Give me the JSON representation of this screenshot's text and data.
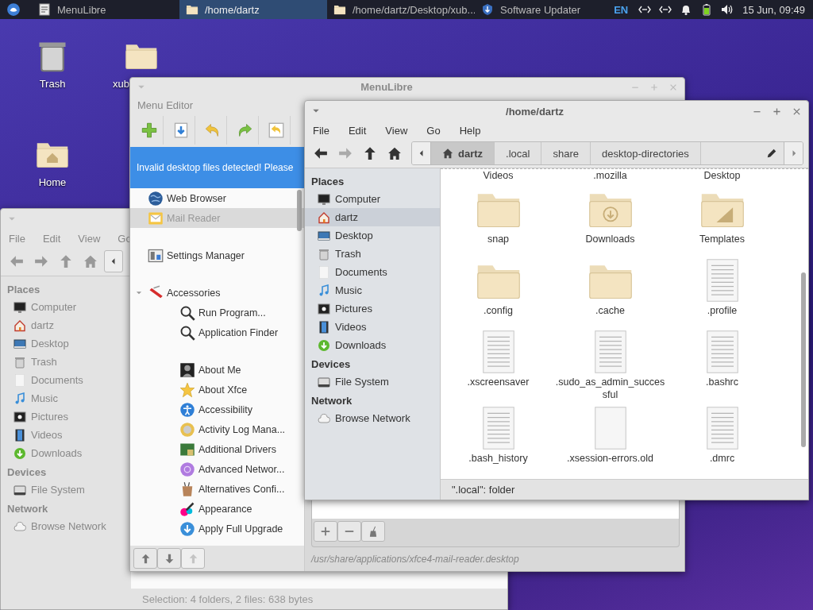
{
  "panel": {
    "tasks": [
      {
        "label": "MenuLibre",
        "kind": "editor",
        "selected": false
      },
      {
        "label": "/home/dartz",
        "kind": "folder",
        "selected": true
      },
      {
        "label": "/home/dartz/Desktop/xub...",
        "kind": "folder",
        "selected": false
      },
      {
        "label": "Software Updater",
        "kind": "updater",
        "selected": false
      }
    ],
    "keyboard_layout": "EN",
    "clock": "15 Jun, 09:49"
  },
  "desktop_icons": [
    {
      "label": "Trash",
      "kind": "trash"
    },
    {
      "label": "xub",
      "kind": "folder"
    },
    {
      "label": "Home",
      "kind": "home-folder"
    }
  ],
  "back_file_manager": {
    "menu": [
      "File",
      "Edit",
      "View",
      "Go"
    ],
    "nav": [
      {
        "kind": "back",
        "disabled": false
      },
      {
        "kind": "forward",
        "disabled": false
      },
      {
        "kind": "up",
        "disabled": false
      },
      {
        "kind": "home",
        "disabled": false
      }
    ],
    "sidebar": [
      {
        "heading": "Places",
        "items": [
          {
            "label": "Computer",
            "kind": "computer",
            "selected": false
          },
          {
            "label": "dartz",
            "kind": "home",
            "selected": false
          },
          {
            "label": "Desktop",
            "kind": "desktop",
            "selected": false
          },
          {
            "label": "Trash",
            "kind": "trash",
            "selected": false
          },
          {
            "label": "Documents",
            "kind": "documents",
            "selected": false
          },
          {
            "label": "Music",
            "kind": "music",
            "selected": false
          },
          {
            "label": "Pictures",
            "kind": "pictures",
            "selected": false
          },
          {
            "label": "Videos",
            "kind": "videos",
            "selected": false
          },
          {
            "label": "Downloads",
            "kind": "downloads",
            "selected": false
          }
        ]
      },
      {
        "heading": "Devices",
        "items": [
          {
            "label": "File System",
            "kind": "drive",
            "selected": false
          }
        ]
      },
      {
        "heading": "Network",
        "items": [
          {
            "label": "Browse Network",
            "kind": "network",
            "selected": false
          }
        ]
      }
    ],
    "status_bar": "Selection: 4 folders, 2 files: 638 bytes"
  },
  "menu_editor": {
    "title": "MenuLibre",
    "header": "Menu Editor",
    "toolbar": [
      {
        "kind": "add",
        "disabled": false
      },
      {
        "kind": "save",
        "disabled": false
      },
      {
        "kind": "undo",
        "disabled": false
      },
      {
        "kind": "redo",
        "disabled": false
      },
      {
        "kind": "revert",
        "disabled": false
      }
    ],
    "info_bar": "Invalid desktop files detected! Please",
    "tree": [
      {
        "label": "Web Browser",
        "kind": "globe",
        "selected": false
      },
      {
        "label": "Mail Reader",
        "kind": "mail",
        "selected": true
      },
      {
        "kind": "separator"
      },
      {
        "label": "Settings Manager",
        "kind": "settings",
        "selected": false
      },
      {
        "kind": "separator"
      },
      {
        "label": "Accessories",
        "kind": "accessories",
        "selected": false,
        "expanded": true,
        "children": [
          {
            "label": "Run Program...",
            "kind": "search",
            "selected": false
          },
          {
            "label": "Application Finder",
            "kind": "search",
            "selected": false
          },
          {
            "kind": "separator"
          },
          {
            "label": "About Me",
            "kind": "person",
            "selected": false
          },
          {
            "label": "About Xfce",
            "kind": "star",
            "selected": false
          },
          {
            "label": "Accessibility",
            "kind": "accessibility",
            "selected": false
          },
          {
            "label": "Activity Log Mana...",
            "kind": "activity",
            "selected": false
          },
          {
            "label": "Additional Drivers",
            "kind": "drivers",
            "selected": false
          },
          {
            "label": "Advanced Networ...",
            "kind": "networker",
            "selected": false
          },
          {
            "label": "Alternatives Confi...",
            "kind": "alternatives",
            "selected": false
          },
          {
            "label": "Appearance",
            "kind": "appearance",
            "selected": false
          },
          {
            "label": "Apply Full Upgrade",
            "kind": "upgrade",
            "selected": false
          }
        ]
      }
    ],
    "tree_buttons": [
      {
        "kind": "up",
        "disabled": false
      },
      {
        "kind": "down",
        "disabled": false
      },
      {
        "kind": "up",
        "disabled": true
      }
    ],
    "list_buttons": [
      {
        "kind": "plus",
        "disabled": false
      },
      {
        "kind": "minus",
        "disabled": false
      },
      {
        "kind": "broom",
        "disabled": false
      }
    ],
    "file_path": "/usr/share/applications/xfce4-mail-reader.desktop"
  },
  "file_manager": {
    "title": "/home/dartz",
    "menu": [
      "File",
      "Edit",
      "View",
      "Go",
      "Help"
    ],
    "nav": [
      {
        "kind": "back",
        "disabled": false
      },
      {
        "kind": "forward",
        "disabled": true
      },
      {
        "kind": "up",
        "disabled": false
      },
      {
        "kind": "home",
        "disabled": false
      }
    ],
    "path_bar": [
      {
        "label": "dartz",
        "home": true,
        "selected": true
      },
      {
        "label": ".local",
        "home": false,
        "selected": false
      },
      {
        "label": "share",
        "home": false,
        "selected": false
      },
      {
        "label": "desktop-directories",
        "home": false,
        "selected": false
      }
    ],
    "sidebar": [
      {
        "heading": "Places",
        "items": [
          {
            "label": "Computer",
            "kind": "computer",
            "selected": false
          },
          {
            "label": "dartz",
            "kind": "home",
            "selected": true
          },
          {
            "label": "Desktop",
            "kind": "desktop",
            "selected": false
          },
          {
            "label": "Trash",
            "kind": "trash",
            "selected": false
          },
          {
            "label": "Documents",
            "kind": "documents",
            "selected": false
          },
          {
            "label": "Music",
            "kind": "music",
            "selected": false
          },
          {
            "label": "Pictures",
            "kind": "pictures",
            "selected": false
          },
          {
            "label": "Videos",
            "kind": "videos",
            "selected": false
          },
          {
            "label": "Downloads",
            "kind": "downloads",
            "selected": false
          }
        ]
      },
      {
        "heading": "Devices",
        "items": [
          {
            "label": "File System",
            "kind": "drive",
            "selected": false
          }
        ]
      },
      {
        "heading": "Network",
        "items": [
          {
            "label": "Browse Network",
            "kind": "network",
            "selected": false
          }
        ]
      }
    ],
    "scrolled_labels": [
      "Videos",
      ".mozilla",
      "Desktop"
    ],
    "files": [
      {
        "name": "snap",
        "kind": "folder"
      },
      {
        "name": "Downloads",
        "kind": "folder-download"
      },
      {
        "name": "Templates",
        "kind": "folder-templates"
      },
      {
        "name": ".config",
        "kind": "folder"
      },
      {
        "name": ".cache",
        "kind": "folder"
      },
      {
        "name": ".profile",
        "kind": "file"
      },
      {
        "name": ".xscreensaver",
        "kind": "file"
      },
      {
        "name": ".sudo_as_admin_successful",
        "kind": "file"
      },
      {
        "name": ".bashrc",
        "kind": "file"
      },
      {
        "name": ".bash_history",
        "kind": "file"
      },
      {
        "name": ".xsession-errors.old",
        "kind": "file-blank"
      },
      {
        "name": ".dmrc",
        "kind": "file"
      }
    ],
    "status_bar": "\".local\": folder"
  }
}
